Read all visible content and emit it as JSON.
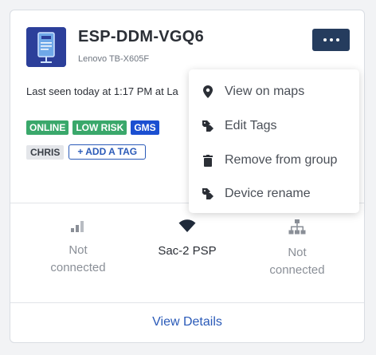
{
  "device": {
    "name": "ESP-DDM-VGQ6",
    "model": "Lenovo TB-X605F",
    "last_seen": "Last seen today at 1:17 PM at La"
  },
  "tags": {
    "status": [
      "ONLINE",
      "LOW RISK",
      "GMS"
    ],
    "user": "CHRIS",
    "add_label": "+ ADD A TAG"
  },
  "stats": {
    "signal": [
      "Not",
      "connected"
    ],
    "wifi": "Sac-2 PSP",
    "network": [
      "Not",
      "connected"
    ]
  },
  "footer": {
    "view_details": "View Details"
  },
  "menu": {
    "items": [
      {
        "label": "View on maps",
        "icon": "map-pin-icon"
      },
      {
        "label": "Edit Tags",
        "icon": "tag-icon"
      },
      {
        "label": "Remove from group",
        "icon": "trash-icon"
      },
      {
        "label": "Device rename",
        "icon": "tag-icon"
      }
    ]
  },
  "colors": {
    "primary_dark": "#253c5e",
    "accent_blue": "#2a5ab8",
    "online_green": "#3aa86b",
    "gms_blue": "#1b4fd1"
  }
}
